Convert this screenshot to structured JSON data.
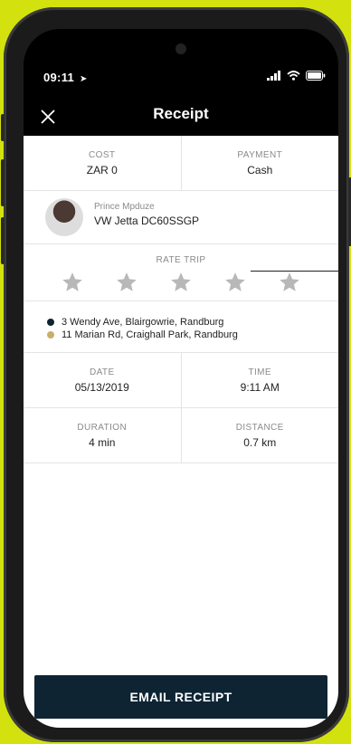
{
  "status": {
    "time": "09:11"
  },
  "header": {
    "title": "Receipt"
  },
  "cost": {
    "label": "COST",
    "value": "ZAR 0"
  },
  "payment": {
    "label": "PAYMENT",
    "value": "Cash"
  },
  "driver": {
    "name": "Prince Mpduze",
    "car": "VW Jetta DC60SSGP"
  },
  "rating": {
    "label": "RATE TRIP",
    "rating_value": 0,
    "max": 5
  },
  "addresses": {
    "pickup": "3 Wendy Ave, Blairgowrie, Randburg",
    "dropoff": "11 Marian Rd, Craighall Park, Randburg"
  },
  "date": {
    "label": "DATE",
    "value": "05/13/2019"
  },
  "time": {
    "label": "TIME",
    "value": "9:11 AM"
  },
  "duration": {
    "label": "DURATION",
    "value": "4 min"
  },
  "distance": {
    "label": "DISTANCE",
    "value": "0.7 km"
  },
  "actions": {
    "email_label": "EMAIL RECEIPT"
  },
  "colors": {
    "background": "#d3e10e",
    "button": "#0e2433",
    "pickup_dot": "#0e2433",
    "dropoff_dot": "#c9ad6a",
    "star_empty": "#b8b8b8"
  }
}
